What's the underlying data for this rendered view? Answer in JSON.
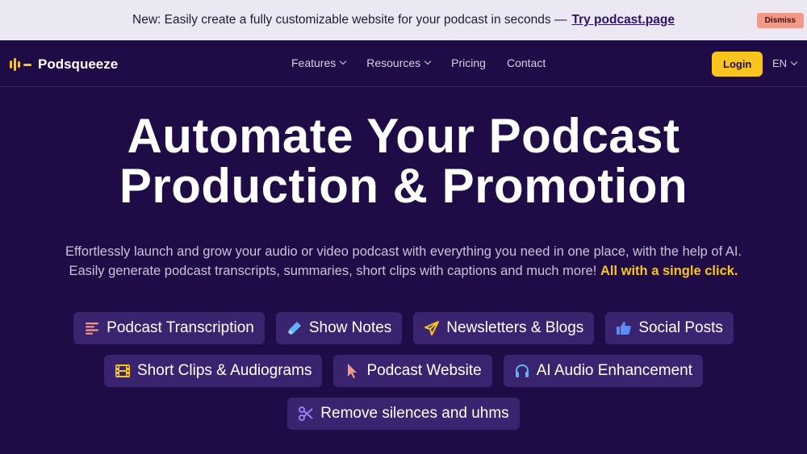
{
  "banner": {
    "text": "New: Easily create a fully customizable website for your podcast in seconds —",
    "link": "Try podcast.page",
    "dismiss": "Dismiss"
  },
  "nav": {
    "logo": "Podsqueeze",
    "items": [
      {
        "label": "Features",
        "dropdown": true
      },
      {
        "label": "Resources",
        "dropdown": true
      },
      {
        "label": "Pricing",
        "dropdown": false
      },
      {
        "label": "Contact",
        "dropdown": false
      }
    ],
    "login": "Login",
    "lang": "EN"
  },
  "hero": {
    "title_line1": "Automate Your Podcast",
    "title_line2": "Production & Promotion",
    "subtitle_line1": "Effortlessly launch and grow your audio or video podcast with everything you need in one place, with the help of AI.",
    "subtitle_line2": "Easily generate podcast transcripts, summaries, short clips with captions and much more!",
    "highlight": "All with a single click."
  },
  "features": [
    {
      "label": "Podcast Transcription",
      "icon": "list-lines-icon"
    },
    {
      "label": "Show Notes",
      "icon": "highlighter-icon"
    },
    {
      "label": "Newsletters & Blogs",
      "icon": "paper-plane-icon"
    },
    {
      "label": "Social Posts",
      "icon": "thumbs-up-icon"
    },
    {
      "label": "Short Clips & Audiograms",
      "icon": "film-icon"
    },
    {
      "label": "Podcast Website",
      "icon": "cursor-icon"
    },
    {
      "label": "AI Audio Enhancement",
      "icon": "headphones-icon"
    },
    {
      "label": "Remove silences and uhms",
      "icon": "scissors-icon"
    }
  ],
  "colors": {
    "background": "#1f0b45",
    "accent": "#f7c51e",
    "chip": "#3a2470",
    "banner": "#ece8f3",
    "dismiss": "#f29a8a"
  }
}
